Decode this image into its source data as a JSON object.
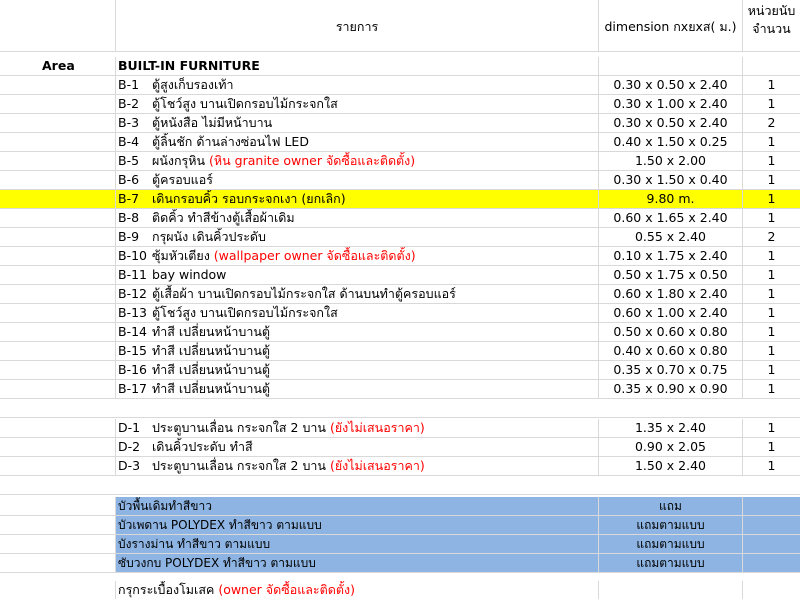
{
  "header": {
    "item_label": "รายการ",
    "dimension_label": "dimension กxยxส( ม.)",
    "unit_label_1": "หน่วยนับ",
    "unit_label_2": "จำนวน"
  },
  "area_label": "Area",
  "section_title": "BUILT-IN  FURNITURE",
  "items": [
    {
      "code": "B-1",
      "desc": "ตู้สูงเก็บรองเท้า",
      "note": "",
      "dim": "0.30 x 0.50 x 2.40",
      "qty": "1",
      "highlight": false
    },
    {
      "code": "B-2",
      "desc": "ตู้โชว์สูง บานเปิดกรอบไม้กระจกใส",
      "note": "",
      "dim": "0.30 x 1.00 x 2.40",
      "qty": "1",
      "highlight": false
    },
    {
      "code": "B-3",
      "desc": "ตู้หนังสือ ไม่มีหน้าบาน",
      "note": "",
      "dim": "0.30 x 0.50 x 2.40",
      "qty": "2",
      "highlight": false
    },
    {
      "code": "B-4",
      "desc": "ตู้ลิ้นชัก ด้านล่างซ่อนไฟ LED",
      "note": "",
      "dim": "0.40 x 1.50 x 0.25",
      "qty": "1",
      "highlight": false
    },
    {
      "code": "B-5",
      "desc": "ผนังกรุหิน",
      "note": "(หิน granite owner จัดซื้อและติดตั้ง)",
      "dim": "1.50 x 2.00",
      "qty": "1",
      "highlight": false
    },
    {
      "code": "B-6",
      "desc": "ตู้ครอบแอร์",
      "note": "",
      "dim": "0.30 x 1.50 x 0.40",
      "qty": "1",
      "highlight": false
    },
    {
      "code": "B-7",
      "desc": "เดินกรอบคิ้ว รอบกระจกเงา (ยกเลิก)",
      "note": "",
      "dim": "9.80 m.",
      "qty": "1",
      "highlight": true
    },
    {
      "code": "B-8",
      "desc": "ติดคิ้ว ทำสีข้างตู้เสื้อผ้าเดิม",
      "note": "",
      "dim": "0.60 x 1.65 x 2.40",
      "qty": "1",
      "highlight": false
    },
    {
      "code": "B-9",
      "desc": "กรุผนัง เดินคิ้วประดับ",
      "note": "",
      "dim": "0.55 x 2.40",
      "qty": "2",
      "highlight": false
    },
    {
      "code": "B-10",
      "desc": "ซุ้มหัวเตียง",
      "note": "(wallpaper owner จัดซื้อและติดตั้ง)",
      "dim": "0.10 x 1.75 x 2.40",
      "qty": "1",
      "highlight": false
    },
    {
      "code": "B-11",
      "desc": "bay window",
      "note": "",
      "dim": "0.50 x 1.75 x 0.50",
      "qty": "1",
      "highlight": false
    },
    {
      "code": "B-12",
      "desc": "ตู้เสื้อผ้า บานเปิดกรอบไม้กระจกใส ด้านบนทำตู้ครอบแอร์",
      "note": "",
      "dim": "0.60 x 1.80 x 2.40",
      "qty": "1",
      "highlight": false
    },
    {
      "code": "B-13",
      "desc": "ตู้โชว์สูง บานเปิดกรอบไม้กระจกใส",
      "note": "",
      "dim": "0.60 x 1.00 x 2.40",
      "qty": "1",
      "highlight": false
    },
    {
      "code": "B-14",
      "desc": "ทำสี เปลี่ยนหน้าบานตู้",
      "note": "",
      "dim": "0.50 x 0.60 x 0.80",
      "qty": "1",
      "highlight": false
    },
    {
      "code": "B-15",
      "desc": "ทำสี เปลี่ยนหน้าบานตู้",
      "note": "",
      "dim": "0.40 x 0.60 x 0.80",
      "qty": "1",
      "highlight": false
    },
    {
      "code": "B-16",
      "desc": "ทำสี เปลี่ยนหน้าบานตู้",
      "note": "",
      "dim": "0.35 x 0.70 x 0.75",
      "qty": "1",
      "highlight": false
    },
    {
      "code": "B-17",
      "desc": "ทำสี เปลี่ยนหน้าบานตู้",
      "note": "",
      "dim": "0.35 x 0.90 x 0.90",
      "qty": "1",
      "highlight": false
    }
  ],
  "doors": [
    {
      "code": "D-1",
      "desc": "ประตูบานเลื่อน กระจกใส 2 บาน",
      "note": "(ยังไม่เสนอราคา)",
      "dim": "1.35 x 2.40",
      "qty": "1"
    },
    {
      "code": "D-2",
      "desc": "เดินคิ้วประดับ ทำสี",
      "note": "",
      "dim": "0.90 x 2.05",
      "qty": "1"
    },
    {
      "code": "D-3",
      "desc": "ประตูบานเลื่อน กระจกใส 2 บาน",
      "note": "(ยังไม่เสนอราคา)",
      "dim": "1.50 x 2.40",
      "qty": "1"
    }
  ],
  "extras": [
    {
      "desc": "บัวพื้นเดิมทำสีขาว",
      "dim": "แถม"
    },
    {
      "desc": "บัวเพดาน  POLYDEX ทำสีขาว ตามแบบ",
      "dim": "แถมตามแบบ"
    },
    {
      "desc": "บังรางม่าน  ทำสีขาว ตามแบบ",
      "dim": "แถมตามแบบ"
    },
    {
      "desc": "ซับวงกบ  POLYDEX ทำสีขาว ตามแบบ",
      "dim": "แถมตามแบบ"
    }
  ],
  "last_row": {
    "desc": "กรุกระเบื้องโมเสค",
    "note": "(owner จัดซื้อและติดตั้ง)"
  },
  "colors": {
    "highlight": "#ffff00",
    "extras_fill": "#8db4e2",
    "note_text": "#ff0000",
    "grid": "#d9d9d9"
  }
}
